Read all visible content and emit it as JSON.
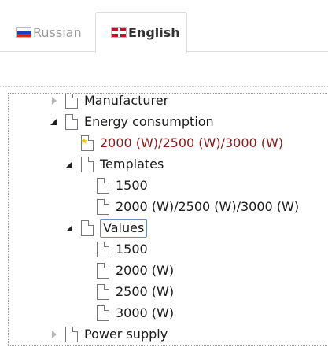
{
  "tabs": [
    {
      "label": "Russian",
      "flag": "russia-flag-icon",
      "active": false
    },
    {
      "label": "English",
      "flag": "uk-flag-icon",
      "active": true
    }
  ],
  "tree": {
    "manufacturer": "Manufacturer",
    "energy_consumption": "Energy consumption",
    "energy_value": "2000 (W)/2500 (W)/3000 (W)",
    "templates": "Templates",
    "template_1500": "1500",
    "template_range": "2000 (W)/2500 (W)/3000 (W)",
    "values": "Values",
    "value_1500": "1500",
    "value_2000": "2000 (W)",
    "value_2500": "2500 (W)",
    "value_3000": "3000 (W)",
    "power_supply": "Power supply"
  },
  "colors": {
    "highlight_text": "#8b1a1a",
    "selected_border": "#6e8fb3",
    "inactive_tab_text": "#9a9a9a"
  }
}
